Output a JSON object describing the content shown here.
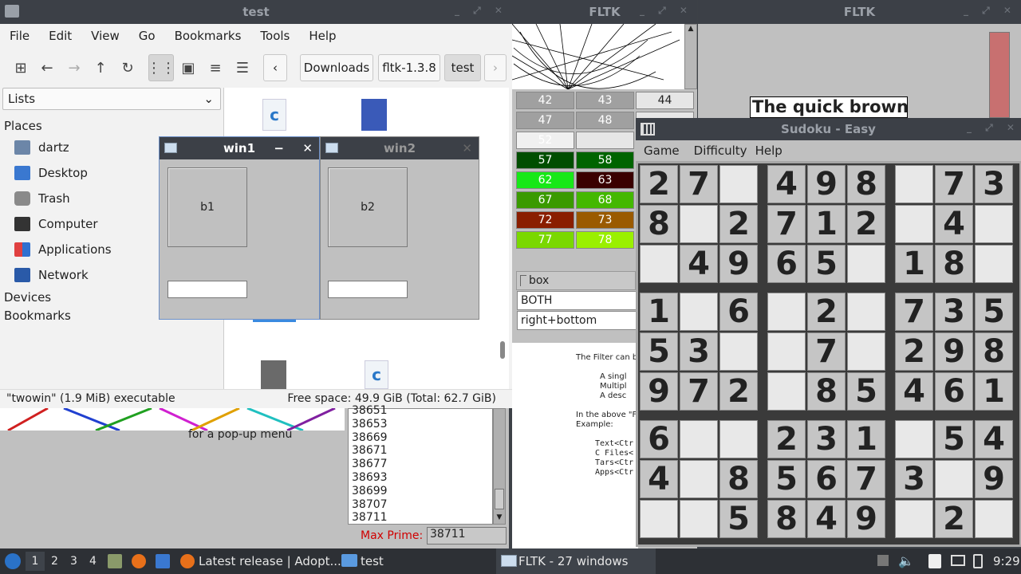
{
  "filemanager": {
    "title": "test",
    "menu": [
      "File",
      "Edit",
      "View",
      "Go",
      "Bookmarks",
      "Tools",
      "Help"
    ],
    "crumbs": [
      "Downloads",
      "fltk-1.3.8",
      "test"
    ],
    "side_select": "Lists",
    "places_header": "Places",
    "places": [
      "dartz",
      "Desktop",
      "Trash",
      "Computer",
      "Applications",
      "Network"
    ],
    "devices_header": "Devices",
    "bookmarks_header": "Bookmarks",
    "status_left": "\"twowin\" (1.9 MiB) executable",
    "status_right": "Free space: 49.9 GiB (Total: 62.7 GiB)"
  },
  "win1": {
    "title": "win1",
    "button": "b1"
  },
  "win2": {
    "title": "win2",
    "button": "b2"
  },
  "fltk_title_1": "FLTK",
  "fltk_title_2": "FLTK",
  "grid_rows": [
    [
      "42",
      "43",
      "44"
    ],
    [
      "47",
      "48",
      ""
    ],
    [
      "52",
      "",
      ""
    ],
    [
      "57",
      "58",
      ""
    ],
    [
      "62",
      "63",
      ""
    ],
    [
      "67",
      "68",
      ""
    ],
    [
      "72",
      "73",
      ""
    ],
    [
      "77",
      "78",
      ""
    ]
  ],
  "grid_colors": [
    [
      "#a0a0a0",
      "#a0a0a0",
      "#e6e6e6"
    ],
    [
      "#a0a0a0",
      "#a0a0a0",
      "#e6e6e6"
    ],
    [
      "#f0f0f0",
      "#e6e6e6",
      "#e6e6e6"
    ],
    [
      "#004e00",
      "#006400",
      "#e6e6e6"
    ],
    [
      "#18e818",
      "#3a0000",
      "#e6e6e6"
    ],
    [
      "#3a9a00",
      "#44b800",
      "#e6e6e6"
    ],
    [
      "#8a1e00",
      "#9a5a00",
      "#e6e6e6"
    ],
    [
      "#7ad800",
      "#9af000",
      "#e6e6e6"
    ]
  ],
  "box_label": "box",
  "choice1": "BOTH",
  "choice2": "right+bottom",
  "quick_brown": "The quick brown",
  "help_text": {
    "line1": "The Filter can b",
    "bullets": [
      "A singl",
      "Multipl",
      "A desc"
    ],
    "line2": "In the above \"F",
    "line3": "Example:",
    "code": [
      "Text<Ctr",
      "C Files<",
      "Tars<Ctr",
      "Apps<Ctr"
    ]
  },
  "primes": [
    "38651",
    "38653",
    "38669",
    "38671",
    "38677",
    "38693",
    "38699",
    "38707",
    "38711"
  ],
  "max_prime_label": "Max Prime:",
  "max_prime_value": "38711",
  "popup_text": "for a pop-up menu",
  "sudoku": {
    "title": "Sudoku - Easy",
    "menu": [
      "Game",
      "Difficulty",
      "Help"
    ],
    "grid": [
      [
        "2",
        "7",
        "",
        "4",
        "9",
        "8",
        "",
        "7",
        "3"
      ],
      [
        "8",
        "",
        "2",
        "7",
        "1",
        "2",
        "",
        "4",
        ""
      ],
      [
        "",
        "4",
        "9",
        "6",
        "5",
        "",
        "1",
        "8",
        ""
      ],
      [
        "1",
        "",
        "6",
        "",
        "2",
        "",
        "7",
        "3",
        "5"
      ],
      [
        "5",
        "3",
        "",
        "",
        "7",
        "",
        "2",
        "9",
        "8"
      ],
      [
        "9",
        "7",
        "2",
        "",
        "8",
        "5",
        "4",
        "6",
        "1"
      ],
      [
        "6",
        "",
        "",
        "2",
        "3",
        "1",
        "",
        "5",
        "4"
      ],
      [
        "4",
        "",
        "8",
        "5",
        "6",
        "7",
        "3",
        "",
        "9"
      ],
      [
        "",
        "",
        "5",
        "8",
        "4",
        "9",
        "",
        "2",
        ""
      ]
    ]
  },
  "taskbar": {
    "workspaces": [
      "1",
      "2",
      "3",
      "4"
    ],
    "task1": "Latest release | Adopt...",
    "task2": "test",
    "task3": "FLTK - 27 windows",
    "clock": "9:29"
  }
}
